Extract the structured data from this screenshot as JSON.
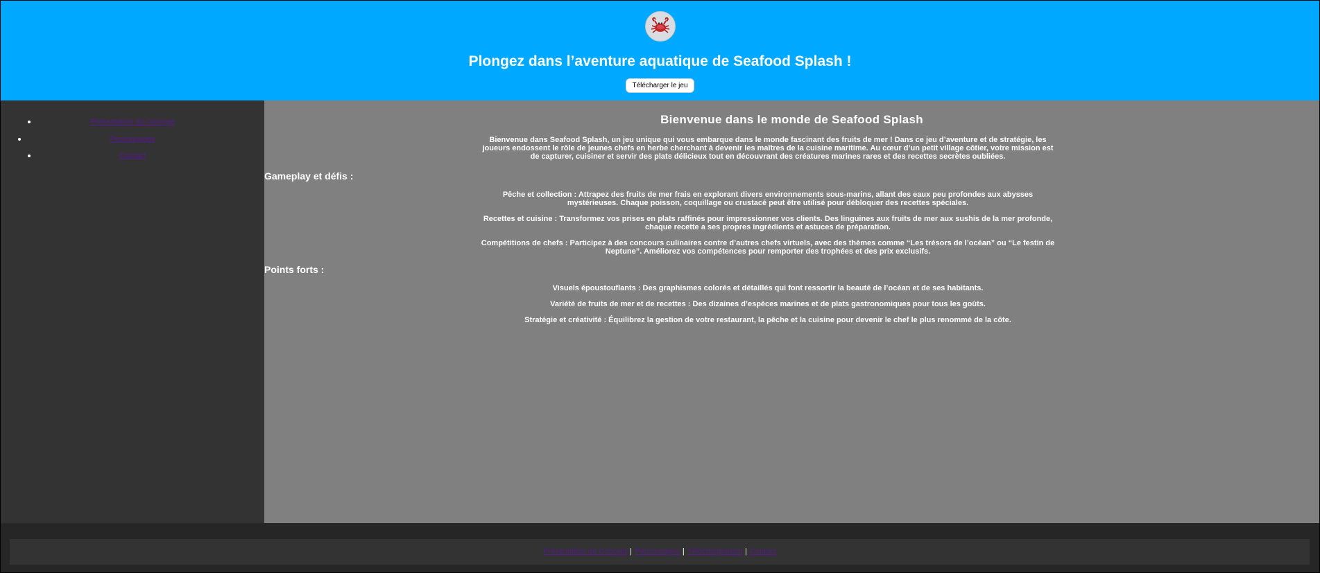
{
  "header": {
    "logo_icon": "crab-icon",
    "title": "Plongez dans l’aventure aquatique de Seafood Splash !",
    "download_label": "Télécharger le jeu",
    "background": "#00a8ff"
  },
  "sidebar": {
    "items": [
      {
        "label": "Présentation du Concept"
      },
      {
        "label": "Personnages"
      },
      {
        "label": "Contact"
      }
    ],
    "background": "#333333",
    "link_color": "#551a8b"
  },
  "main": {
    "title": "Bienvenue dans le monde de Seafood Splash",
    "intro": "Bienvenue dans Seafood Splash, un jeu unique qui vous embarque dans le monde fascinant des fruits de mer ! Dans ce jeu d’aventure et de stratégie, les joueurs endossent le rôle de jeunes chefs en herbe cherchant à devenir les maîtres de la cuisine maritime. Au cœur d’un petit village côtier, votre mission est de capturer, cuisiner et servir des plats délicieux tout en découvrant des créatures marines rares et des recettes secrètes oubliées.",
    "gameplay_heading": "Gameplay et défis :",
    "gameplay_items": [
      "Pêche et collection : Attrapez des fruits de mer frais en explorant divers environnements sous-marins, allant des eaux peu profondes aux abysses mystérieuses. Chaque poisson, coquillage ou crustacé peut être utilisé pour débloquer des recettes spéciales.",
      "Recettes et cuisine : Transformez vos prises en plats raffinés pour impressionner vos clients. Des linguines aux fruits de mer aux sushis de la mer profonde, chaque recette a ses propres ingrédients et astuces de préparation.",
      "Compétitions de chefs : Participez à des concours culinaires contre d’autres chefs virtuels, avec des thèmes comme “Les trésors de l’océan” ou “Le festin de Neptune”. Améliorez vos compétences pour remporter des trophées et des prix exclusifs."
    ],
    "highlights_heading": "Points forts :",
    "highlight_items": [
      "Visuels époustouflants : Des graphismes colorés et détaillés qui font ressortir la beauté de l’océan et de ses habitants.",
      "Variété de fruits de mer et de recettes : Des dizaines d’espèces marines et de plats gastronomiques pour tous les goûts.",
      "Stratégie et créativité : Équilibrez la gestion de votre restaurant, la pêche et la cuisine pour devenir le chef le plus renommé de la côte."
    ],
    "background": "#808080"
  },
  "footer": {
    "links": [
      {
        "label": "Présentation du Concept"
      },
      {
        "label": "Personnages"
      },
      {
        "label": "Téléchargement"
      },
      {
        "label": "Contact"
      }
    ],
    "separator": "|"
  }
}
